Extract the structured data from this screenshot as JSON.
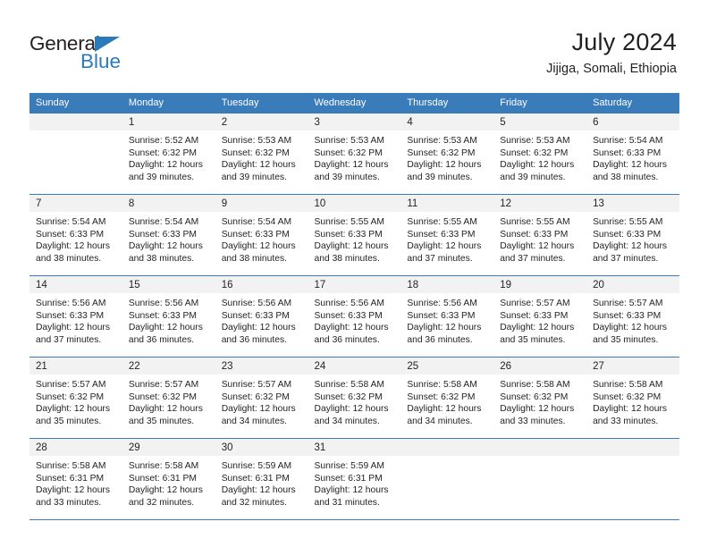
{
  "brand": {
    "name_top": "General",
    "name_bottom": "Blue",
    "accent_color": "#2b7bba"
  },
  "header": {
    "title": "July 2024",
    "subtitle": "Jijiga, Somali, Ethiopia"
  },
  "calendar": {
    "header_bg": "#3a7cba",
    "daynum_bg": "#f2f2f2",
    "weekdays": [
      "Sunday",
      "Monday",
      "Tuesday",
      "Wednesday",
      "Thursday",
      "Friday",
      "Saturday"
    ],
    "weeks": [
      [
        {
          "day": "",
          "sunrise": "",
          "sunset": "",
          "daylight_1": "",
          "daylight_2": ""
        },
        {
          "day": "1",
          "sunrise": "Sunrise: 5:52 AM",
          "sunset": "Sunset: 6:32 PM",
          "daylight_1": "Daylight: 12 hours",
          "daylight_2": "and 39 minutes."
        },
        {
          "day": "2",
          "sunrise": "Sunrise: 5:53 AM",
          "sunset": "Sunset: 6:32 PM",
          "daylight_1": "Daylight: 12 hours",
          "daylight_2": "and 39 minutes."
        },
        {
          "day": "3",
          "sunrise": "Sunrise: 5:53 AM",
          "sunset": "Sunset: 6:32 PM",
          "daylight_1": "Daylight: 12 hours",
          "daylight_2": "and 39 minutes."
        },
        {
          "day": "4",
          "sunrise": "Sunrise: 5:53 AM",
          "sunset": "Sunset: 6:32 PM",
          "daylight_1": "Daylight: 12 hours",
          "daylight_2": "and 39 minutes."
        },
        {
          "day": "5",
          "sunrise": "Sunrise: 5:53 AM",
          "sunset": "Sunset: 6:32 PM",
          "daylight_1": "Daylight: 12 hours",
          "daylight_2": "and 39 minutes."
        },
        {
          "day": "6",
          "sunrise": "Sunrise: 5:54 AM",
          "sunset": "Sunset: 6:33 PM",
          "daylight_1": "Daylight: 12 hours",
          "daylight_2": "and 38 minutes."
        }
      ],
      [
        {
          "day": "7",
          "sunrise": "Sunrise: 5:54 AM",
          "sunset": "Sunset: 6:33 PM",
          "daylight_1": "Daylight: 12 hours",
          "daylight_2": "and 38 minutes."
        },
        {
          "day": "8",
          "sunrise": "Sunrise: 5:54 AM",
          "sunset": "Sunset: 6:33 PM",
          "daylight_1": "Daylight: 12 hours",
          "daylight_2": "and 38 minutes."
        },
        {
          "day": "9",
          "sunrise": "Sunrise: 5:54 AM",
          "sunset": "Sunset: 6:33 PM",
          "daylight_1": "Daylight: 12 hours",
          "daylight_2": "and 38 minutes."
        },
        {
          "day": "10",
          "sunrise": "Sunrise: 5:55 AM",
          "sunset": "Sunset: 6:33 PM",
          "daylight_1": "Daylight: 12 hours",
          "daylight_2": "and 38 minutes."
        },
        {
          "day": "11",
          "sunrise": "Sunrise: 5:55 AM",
          "sunset": "Sunset: 6:33 PM",
          "daylight_1": "Daylight: 12 hours",
          "daylight_2": "and 37 minutes."
        },
        {
          "day": "12",
          "sunrise": "Sunrise: 5:55 AM",
          "sunset": "Sunset: 6:33 PM",
          "daylight_1": "Daylight: 12 hours",
          "daylight_2": "and 37 minutes."
        },
        {
          "day": "13",
          "sunrise": "Sunrise: 5:55 AM",
          "sunset": "Sunset: 6:33 PM",
          "daylight_1": "Daylight: 12 hours",
          "daylight_2": "and 37 minutes."
        }
      ],
      [
        {
          "day": "14",
          "sunrise": "Sunrise: 5:56 AM",
          "sunset": "Sunset: 6:33 PM",
          "daylight_1": "Daylight: 12 hours",
          "daylight_2": "and 37 minutes."
        },
        {
          "day": "15",
          "sunrise": "Sunrise: 5:56 AM",
          "sunset": "Sunset: 6:33 PM",
          "daylight_1": "Daylight: 12 hours",
          "daylight_2": "and 36 minutes."
        },
        {
          "day": "16",
          "sunrise": "Sunrise: 5:56 AM",
          "sunset": "Sunset: 6:33 PM",
          "daylight_1": "Daylight: 12 hours",
          "daylight_2": "and 36 minutes."
        },
        {
          "day": "17",
          "sunrise": "Sunrise: 5:56 AM",
          "sunset": "Sunset: 6:33 PM",
          "daylight_1": "Daylight: 12 hours",
          "daylight_2": "and 36 minutes."
        },
        {
          "day": "18",
          "sunrise": "Sunrise: 5:56 AM",
          "sunset": "Sunset: 6:33 PM",
          "daylight_1": "Daylight: 12 hours",
          "daylight_2": "and 36 minutes."
        },
        {
          "day": "19",
          "sunrise": "Sunrise: 5:57 AM",
          "sunset": "Sunset: 6:33 PM",
          "daylight_1": "Daylight: 12 hours",
          "daylight_2": "and 35 minutes."
        },
        {
          "day": "20",
          "sunrise": "Sunrise: 5:57 AM",
          "sunset": "Sunset: 6:33 PM",
          "daylight_1": "Daylight: 12 hours",
          "daylight_2": "and 35 minutes."
        }
      ],
      [
        {
          "day": "21",
          "sunrise": "Sunrise: 5:57 AM",
          "sunset": "Sunset: 6:32 PM",
          "daylight_1": "Daylight: 12 hours",
          "daylight_2": "and 35 minutes."
        },
        {
          "day": "22",
          "sunrise": "Sunrise: 5:57 AM",
          "sunset": "Sunset: 6:32 PM",
          "daylight_1": "Daylight: 12 hours",
          "daylight_2": "and 35 minutes."
        },
        {
          "day": "23",
          "sunrise": "Sunrise: 5:57 AM",
          "sunset": "Sunset: 6:32 PM",
          "daylight_1": "Daylight: 12 hours",
          "daylight_2": "and 34 minutes."
        },
        {
          "day": "24",
          "sunrise": "Sunrise: 5:58 AM",
          "sunset": "Sunset: 6:32 PM",
          "daylight_1": "Daylight: 12 hours",
          "daylight_2": "and 34 minutes."
        },
        {
          "day": "25",
          "sunrise": "Sunrise: 5:58 AM",
          "sunset": "Sunset: 6:32 PM",
          "daylight_1": "Daylight: 12 hours",
          "daylight_2": "and 34 minutes."
        },
        {
          "day": "26",
          "sunrise": "Sunrise: 5:58 AM",
          "sunset": "Sunset: 6:32 PM",
          "daylight_1": "Daylight: 12 hours",
          "daylight_2": "and 33 minutes."
        },
        {
          "day": "27",
          "sunrise": "Sunrise: 5:58 AM",
          "sunset": "Sunset: 6:32 PM",
          "daylight_1": "Daylight: 12 hours",
          "daylight_2": "and 33 minutes."
        }
      ],
      [
        {
          "day": "28",
          "sunrise": "Sunrise: 5:58 AM",
          "sunset": "Sunset: 6:31 PM",
          "daylight_1": "Daylight: 12 hours",
          "daylight_2": "and 33 minutes."
        },
        {
          "day": "29",
          "sunrise": "Sunrise: 5:58 AM",
          "sunset": "Sunset: 6:31 PM",
          "daylight_1": "Daylight: 12 hours",
          "daylight_2": "and 32 minutes."
        },
        {
          "day": "30",
          "sunrise": "Sunrise: 5:59 AM",
          "sunset": "Sunset: 6:31 PM",
          "daylight_1": "Daylight: 12 hours",
          "daylight_2": "and 32 minutes."
        },
        {
          "day": "31",
          "sunrise": "Sunrise: 5:59 AM",
          "sunset": "Sunset: 6:31 PM",
          "daylight_1": "Daylight: 12 hours",
          "daylight_2": "and 31 minutes."
        },
        {
          "day": "",
          "sunrise": "",
          "sunset": "",
          "daylight_1": "",
          "daylight_2": ""
        },
        {
          "day": "",
          "sunrise": "",
          "sunset": "",
          "daylight_1": "",
          "daylight_2": ""
        },
        {
          "day": "",
          "sunrise": "",
          "sunset": "",
          "daylight_1": "",
          "daylight_2": ""
        }
      ]
    ]
  }
}
